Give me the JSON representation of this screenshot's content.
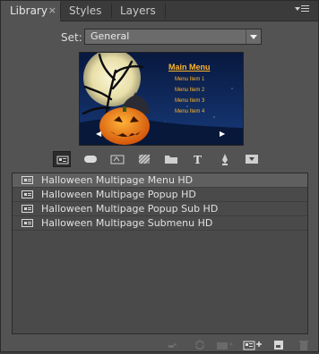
{
  "tabs": [
    {
      "label": "Library",
      "active": true,
      "close": "×"
    },
    {
      "label": "Styles",
      "active": false
    },
    {
      "label": "Layers",
      "active": false
    }
  ],
  "set": {
    "label": "Set:",
    "value": "General"
  },
  "preview": {
    "title": "Main Menu",
    "items": [
      "Menu Item 1",
      "Menu Item 2",
      "Menu Item 3",
      "Menu Item 4"
    ],
    "nav_left": "◀",
    "nav_right": "▶"
  },
  "toolbar_icons": [
    "menu-icon",
    "button-icon",
    "text-button-icon",
    "pattern-icon",
    "folder-icon",
    "text-icon",
    "pen-icon",
    "download-icon"
  ],
  "list": {
    "items": [
      {
        "label": "Halloween Multipage Menu HD",
        "selected": true
      },
      {
        "label": "Halloween Multipage Popup HD",
        "selected": false
      },
      {
        "label": "Halloween Multipage Popup Sub HD",
        "selected": false
      },
      {
        "label": "Halloween Multipage Submenu HD",
        "selected": false
      }
    ]
  },
  "bottom_icons": [
    "arrow-icon",
    "sync-icon",
    "new-layer-icon",
    "new-menu-icon",
    "import-icon",
    "trash-icon"
  ],
  "colors": {
    "accent": "#ffb52a",
    "panel": "#535353",
    "list_bg": "#4a4a4a"
  }
}
